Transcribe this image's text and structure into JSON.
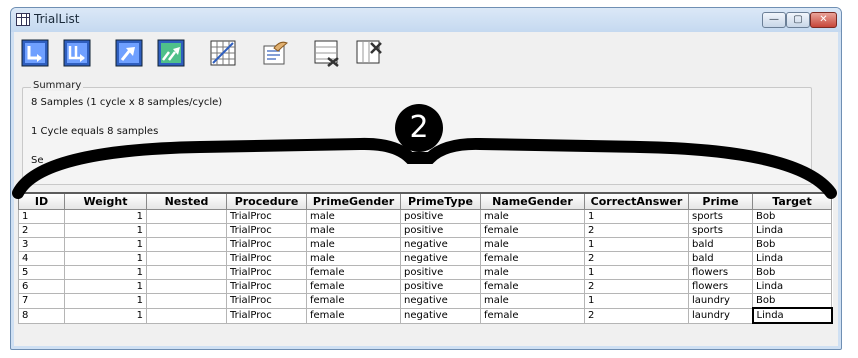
{
  "window": {
    "title": "TrialList",
    "minimize_label": "—",
    "maximize_label": "▢",
    "close_label": "✕"
  },
  "toolbar": {
    "buttons": [
      {
        "name": "add-level-button",
        "icon": "add-level-icon"
      },
      {
        "name": "add-multiple-levels-button",
        "icon": "add-multiple-levels-icon"
      },
      {
        "name": "insert-level-button",
        "icon": "insert-level-icon"
      },
      {
        "name": "insert-multiple-levels-button",
        "icon": "insert-multiple-levels-icon"
      },
      {
        "name": "grid-button",
        "icon": "grid-icon"
      },
      {
        "name": "properties-button",
        "icon": "properties-icon"
      },
      {
        "name": "remove-levels-button",
        "icon": "remove-levels-icon"
      },
      {
        "name": "remove-attributes-button",
        "icon": "remove-attributes-icon"
      }
    ]
  },
  "summary": {
    "legend": "Summary",
    "line1": "8 Samples (1 cycle x 8 samples/cycle)",
    "line2": "1 Cycle equals 8 samples",
    "line3": "Se"
  },
  "callout": {
    "number": "2"
  },
  "table": {
    "columns": [
      "ID",
      "Weight",
      "Nested",
      "Procedure",
      "PrimeGender",
      "PrimeType",
      "NameGender",
      "CorrectAnswer",
      "Prime",
      "Target"
    ],
    "rows": [
      [
        "1",
        "1",
        "",
        "TrialProc",
        "male",
        "positive",
        "male",
        "1",
        "sports",
        "Bob"
      ],
      [
        "2",
        "1",
        "",
        "TrialProc",
        "male",
        "positive",
        "female",
        "2",
        "sports",
        "Linda"
      ],
      [
        "3",
        "1",
        "",
        "TrialProc",
        "male",
        "negative",
        "male",
        "1",
        "bald",
        "Bob"
      ],
      [
        "4",
        "1",
        "",
        "TrialProc",
        "male",
        "negative",
        "female",
        "2",
        "bald",
        "Linda"
      ],
      [
        "5",
        "1",
        "",
        "TrialProc",
        "female",
        "positive",
        "male",
        "1",
        "flowers",
        "Bob"
      ],
      [
        "6",
        "1",
        "",
        "TrialProc",
        "female",
        "positive",
        "female",
        "2",
        "flowers",
        "Linda"
      ],
      [
        "7",
        "1",
        "",
        "TrialProc",
        "female",
        "negative",
        "male",
        "1",
        "laundry",
        "Bob"
      ],
      [
        "8",
        "1",
        "",
        "TrialProc",
        "female",
        "negative",
        "female",
        "2",
        "laundry",
        "Linda"
      ]
    ]
  },
  "colors": {
    "accent_blue": "#2f5fbf",
    "callout": "#000000",
    "close_red": "#c7463a"
  }
}
